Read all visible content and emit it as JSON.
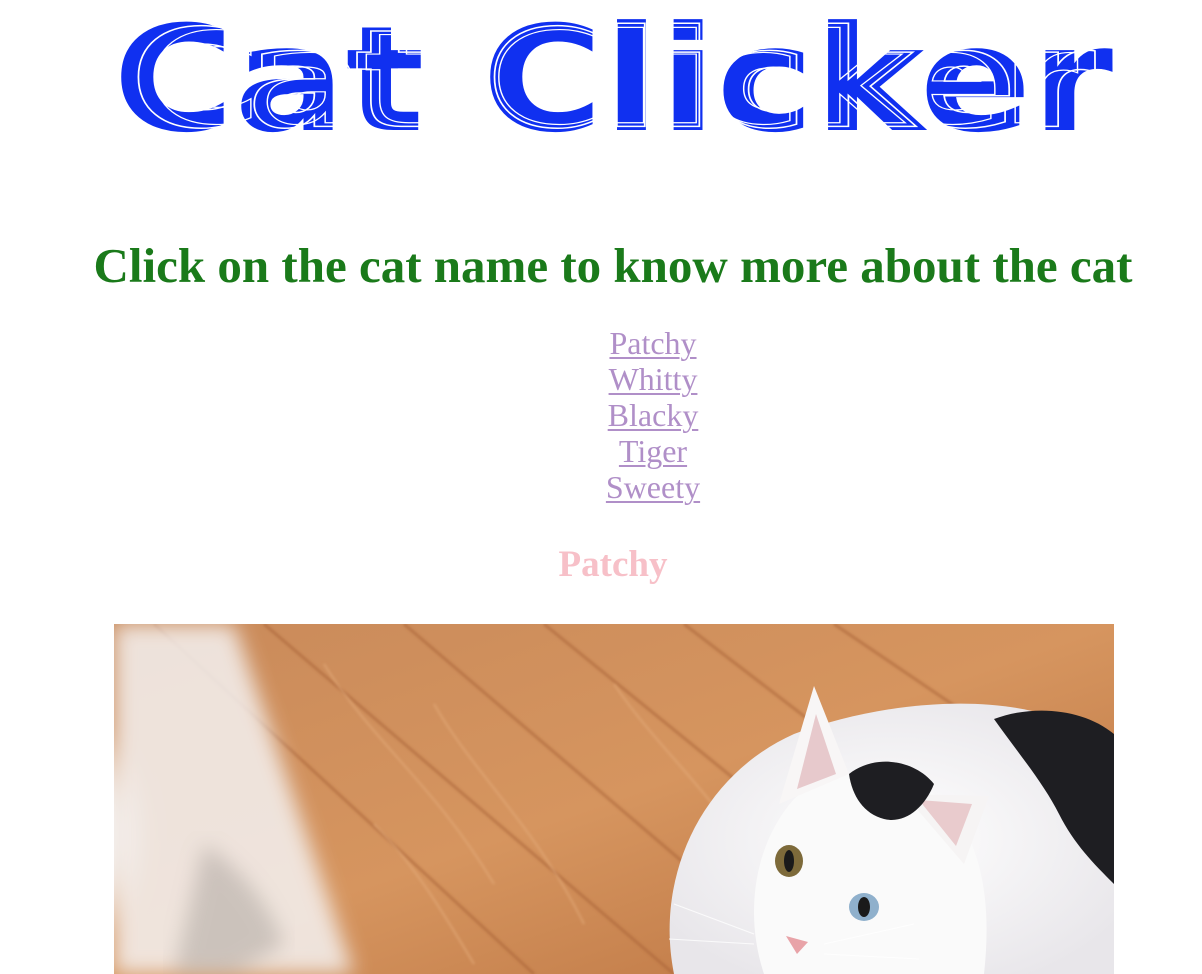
{
  "header": {
    "logo_text": "Cat Clicker",
    "logo_color": "#1030f0"
  },
  "instruction": {
    "text": "Click on the cat name to know more about the cat",
    "color": "#1a7a1a"
  },
  "cats": {
    "link_color": "#b08fc8",
    "items": [
      {
        "label": "Patchy"
      },
      {
        "label": "Whitty"
      },
      {
        "label": "Blacky"
      },
      {
        "label": "Tiger"
      },
      {
        "label": "Sweety"
      }
    ]
  },
  "selected_cat": {
    "name": "Patchy",
    "color": "#f7c0c8",
    "photo_icon": "cat-photo-image"
  }
}
